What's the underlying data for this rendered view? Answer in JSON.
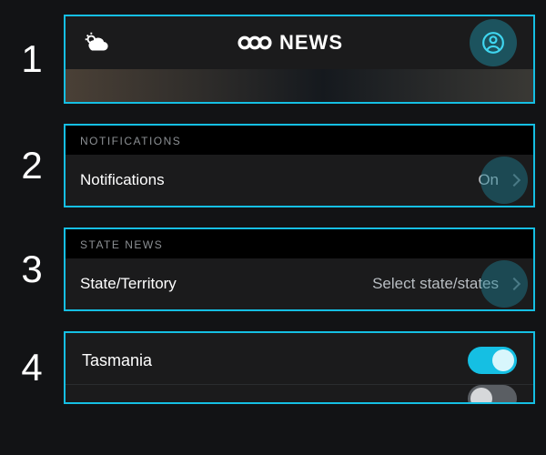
{
  "steps": [
    "1",
    "2",
    "3",
    "4"
  ],
  "header": {
    "brand_text": "NEWS"
  },
  "notifications": {
    "section_label": "NOTIFICATIONS",
    "row_label": "Notifications",
    "row_value": "On"
  },
  "state_news": {
    "section_label": "STATE NEWS",
    "row_label": "State/Territory",
    "row_value": "Select state/states"
  },
  "states": {
    "item0": {
      "label": "Tasmania",
      "on": true
    }
  }
}
